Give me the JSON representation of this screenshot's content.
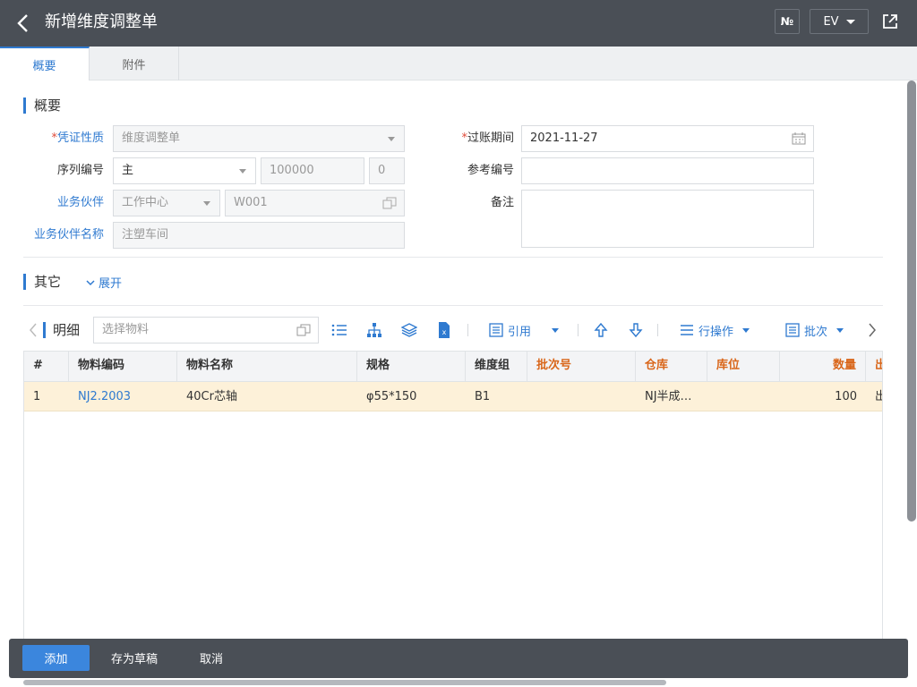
{
  "header": {
    "title": "新增维度调整单",
    "no_label": "№",
    "ev_label": "EV"
  },
  "tabs": [
    {
      "label": "概要"
    },
    {
      "label": "附件"
    }
  ],
  "overview": {
    "section_title": "概要",
    "fields": {
      "voucher_type": {
        "label": "凭证性质",
        "value": "维度调整单"
      },
      "serial": {
        "label": "序列编号",
        "value": "主",
        "placeholder": "100000",
        "suffix": "0"
      },
      "partner": {
        "label": "业务伙伴",
        "type_value": "工作中心",
        "code_placeholder": "W001"
      },
      "partner_name": {
        "label": "业务伙伴名称",
        "placeholder": "注塑车间"
      },
      "posting_period": {
        "label": "过账期间",
        "value": "2021-11-27"
      },
      "reference": {
        "label": "参考编号",
        "value": ""
      },
      "remark": {
        "label": "备注",
        "value": ""
      }
    },
    "required_mark": "*"
  },
  "other": {
    "section_title": "其它",
    "expand_label": "展开"
  },
  "detail": {
    "title": "明细",
    "search_placeholder": "选择物料",
    "cite_label": "引用",
    "row_ops_label": "行操作",
    "batch_label": "批次",
    "columns": [
      "#",
      "物料编码",
      "物料名称",
      "规格",
      "维度组",
      "批次号",
      "仓库",
      "库位",
      "数量",
      "出"
    ],
    "rows": [
      {
        "index": "1",
        "code": "NJ2.2003",
        "name": "40Cr芯轴",
        "spec": "φ55*150",
        "dim_group": "B1",
        "batch": "",
        "warehouse": "NJ半成…",
        "location": "",
        "qty": "100",
        "out": "出"
      }
    ]
  },
  "footer": {
    "add_label": "添加",
    "draft_label": "存为草稿",
    "cancel_label": "取消"
  }
}
